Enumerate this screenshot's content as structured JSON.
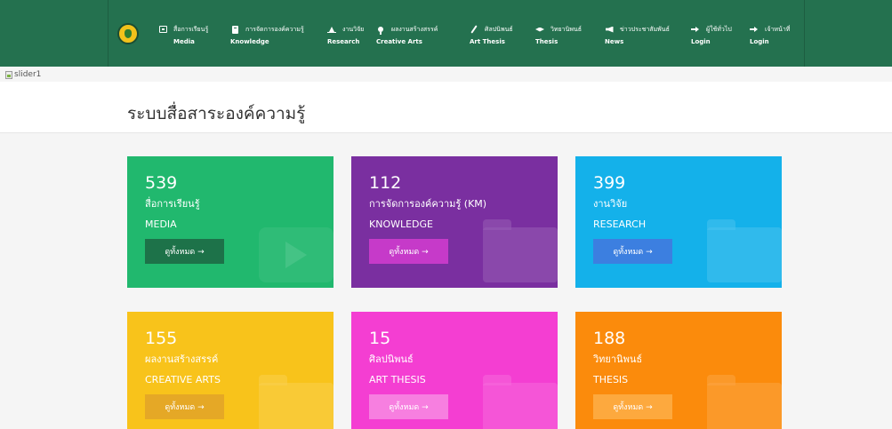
{
  "nav": {
    "items": [
      {
        "icon": "media-icon",
        "th": "สื่อการเรียนรู้",
        "en": "Media"
      },
      {
        "icon": "book-icon",
        "th": "การจัดการองค์ความรู้",
        "en": "Knowledge"
      },
      {
        "icon": "chart-icon",
        "th": "งานวิจัย",
        "en": "Research"
      },
      {
        "icon": "lightbulb-icon",
        "th": "ผลงานสร้างสรรค์",
        "en": "Creative Arts"
      },
      {
        "icon": "pen-icon",
        "th": "ศิลปนิพนธ์",
        "en": "Art Thesis"
      },
      {
        "icon": "graduation-cap-icon",
        "th": "วิทยานิพนธ์",
        "en": "Thesis"
      },
      {
        "icon": "megaphone-icon",
        "th": "ข่าวประชาสัมพันธ์",
        "en": "News"
      },
      {
        "icon": "login-icon",
        "th": "ผู้ใช้ทั่วไป",
        "en": "Login"
      },
      {
        "icon": "login-icon",
        "th": "เจ้าหน้าที่",
        "en": "Login"
      }
    ]
  },
  "slider": {
    "alt": "slider1"
  },
  "page": {
    "title": "ระบบสื่อสาระองค์ความรู้"
  },
  "cards": [
    {
      "count": "539",
      "th": "สื่อการเรียนรู้",
      "en": "MEDIA",
      "button": "ดูทั้งหมด →",
      "color": "#21b86e",
      "btn_color": "#1d7249",
      "icon": "play-icon"
    },
    {
      "count": "112",
      "th": "การจัดการองค์ความรู้ (KM)",
      "en": "KNOWLEDGE",
      "button": "ดูทั้งหมด →",
      "color": "#7a2fa0",
      "btn_color": "#c63ac9",
      "icon": "folder-icon"
    },
    {
      "count": "399",
      "th": "งานวิจัย",
      "en": "RESEARCH",
      "button": "ดูทั้งหมด →",
      "color": "#14b1ea",
      "btn_color": "#3c7fe0",
      "icon": "folder-icon"
    },
    {
      "count": "155",
      "th": "ผลงานสร้างสรรค์",
      "en": "CREATIVE ARTS",
      "button": "ดูทั้งหมด →",
      "color": "#f8c31b",
      "btn_color": "#e5a826",
      "icon": "folder-icon"
    },
    {
      "count": "15",
      "th": "ศิลปนิพนธ์",
      "en": "ART THESIS",
      "button": "ดูทั้งหมด →",
      "color": "#f43ed2",
      "btn_color": "#f77fe0",
      "icon": "folder-icon"
    },
    {
      "count": "188",
      "th": "วิทยานิพนธ์",
      "en": "THESIS",
      "button": "ดูทั้งหมด →",
      "color": "#fb8b0c",
      "btn_color": "#fda93e",
      "icon": "folder-icon"
    }
  ]
}
